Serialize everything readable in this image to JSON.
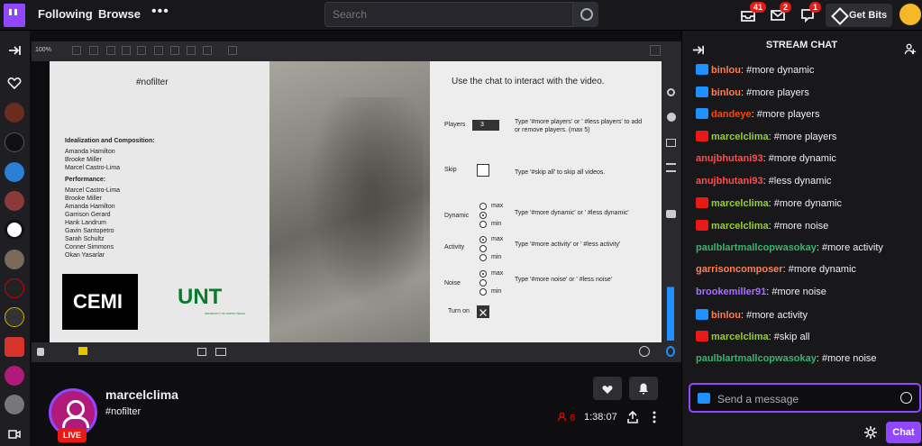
{
  "nav": {
    "following": "Following",
    "browse": "Browse",
    "more": "•••",
    "search_placeholder": "Search",
    "inbox_count": "41",
    "whispers_count": "2",
    "notifications_count": "1",
    "get_bits": "Get Bits"
  },
  "player": {
    "zoom": "100%",
    "slide": {
      "hashtag": "#nofilter",
      "idealization_heading": "Idealization and Composition:",
      "idealization_names": [
        "Amanda Hamilton",
        "Brooke Miller",
        "Marcel Castro-Lima"
      ],
      "performance_heading": "Performance:",
      "performance_names": [
        "Marcel Castro-Lima",
        "Brooke Miller",
        "Amanda Hamilton",
        "Garrison Gerard",
        "Hank Landrum",
        "Gavin Santopetro",
        "Sarah Schultz",
        "Conner Simmons",
        "Okan Yasarlar"
      ],
      "cemi_logo": "CEMI",
      "unt_logo": "UNT",
      "unt_sub": "UNIVERSITY OF NORTH TEXAS",
      "instructions_title": "Use the chat to interact with the video.",
      "players_label": "Players",
      "players_value": "3",
      "players_help": "Type '#more players' or ' #less players' to add or remove players. (max 5)",
      "skip_label": "Skip",
      "skip_help": "Type '#skip all' to skip all videos.",
      "dynamic_label": "Dynamic",
      "dynamic_help": "Type '#more dynamic' or ' #less dynamic'",
      "activity_label": "Activity",
      "activity_help": "Type '#more activity' or ' #less activity'",
      "noise_label": "Noise",
      "noise_help": "Type '#more noise' or ' #less noise'",
      "turnon_label": "Turn on",
      "max": "max",
      "min": "min"
    }
  },
  "channel": {
    "name": "marcelclima",
    "title": "#nofilter",
    "live": "LIVE",
    "viewers": "6",
    "uptime": "1:38:07"
  },
  "chat": {
    "header": "STREAM CHAT",
    "messages": [
      {
        "badge": "blue",
        "user": "binlou",
        "color": "#ff7f50",
        "text": "#more dynamic"
      },
      {
        "badge": "blue",
        "user": "binlou",
        "color": "#ff7f50",
        "text": "#more players"
      },
      {
        "badge": "blue",
        "user": "dandeye",
        "color": "#ff4500",
        "text": "#more players"
      },
      {
        "badge": "red",
        "user": "marcelclima",
        "color": "#9acd32",
        "text": "#more players"
      },
      {
        "badge": "",
        "user": "anujbhutani93",
        "color": "#ff4d4d",
        "text": "#more dynamic"
      },
      {
        "badge": "",
        "user": "anujbhutani93",
        "color": "#ff4d4d",
        "text": "#less dynamic"
      },
      {
        "badge": "red",
        "user": "marcelclima",
        "color": "#9acd32",
        "text": "#more dynamic"
      },
      {
        "badge": "red",
        "user": "marcelclima",
        "color": "#9acd32",
        "text": "#more noise"
      },
      {
        "badge": "",
        "user": "paulblartmallcopwasokay",
        "color": "#3cb371",
        "text": "#more activity"
      },
      {
        "badge": "",
        "user": "garrisoncomposer",
        "color": "#ff7f50",
        "text": "#more dynamic"
      },
      {
        "badge": "",
        "user": "brookemiller91",
        "color": "#a970ff",
        "text": "#more noise"
      },
      {
        "badge": "blue",
        "user": "binlou",
        "color": "#ff7f50",
        "text": "#more activity"
      },
      {
        "badge": "red",
        "user": "marcelclima",
        "color": "#9acd32",
        "text": "#skip all"
      },
      {
        "badge": "",
        "user": "paulblartmallcopwasokay",
        "color": "#3cb371",
        "text": "#more noise"
      }
    ],
    "input_placeholder": "Send a message",
    "send": "Chat"
  },
  "colors": {
    "accent": "#9147ff",
    "live": "#e91916"
  }
}
